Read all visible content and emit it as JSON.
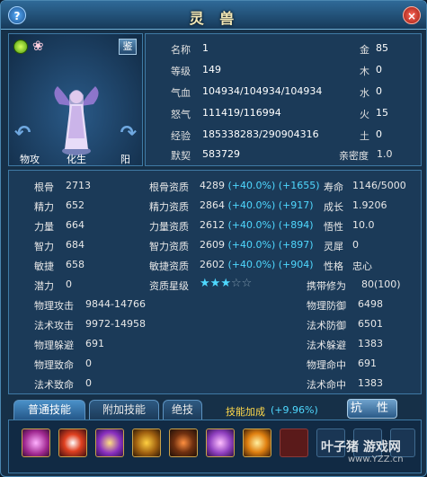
{
  "window": {
    "title": "灵 兽",
    "help": "?",
    "close": "×"
  },
  "portrait": {
    "appraise": "鉴",
    "tags": [
      "物攻",
      "化生",
      "阳"
    ]
  },
  "basic": [
    {
      "label": "名称",
      "value": "1",
      "label2": "金",
      "value2": "85"
    },
    {
      "label": "等级",
      "value": "149",
      "label2": "木",
      "value2": "0"
    },
    {
      "label": "气血",
      "value": "104934/104934/104934",
      "label2": "水",
      "value2": "0"
    },
    {
      "label": "怒气",
      "value": "111419/116994",
      "label2": "火",
      "value2": "15"
    },
    {
      "label": "经验",
      "value": "185338283/290904316",
      "label2": "土",
      "value2": "0"
    },
    {
      "label": "默契",
      "value": "583729",
      "label2": "亲密度",
      "value2": "1.0"
    }
  ],
  "attributes": [
    {
      "l1": "根骨",
      "v1": "2713",
      "l2": "根骨资质",
      "v2": "4289",
      "b1": "(+40.0%)",
      "b2": "(+1655)",
      "l3": "寿命",
      "v3": "1146/5000"
    },
    {
      "l1": "精力",
      "v1": "652",
      "l2": "精力资质",
      "v2": "2864",
      "b1": "(+40.0%)",
      "b2": "(+917)",
      "l3": "成长",
      "v3": "1.9206"
    },
    {
      "l1": "力量",
      "v1": "664",
      "l2": "力量资质",
      "v2": "2612",
      "b1": "(+40.0%)",
      "b2": "(+894)",
      "l3": "悟性",
      "v3": "10.0"
    },
    {
      "l1": "智力",
      "v1": "684",
      "l2": "智力资质",
      "v2": "2609",
      "b1": "(+40.0%)",
      "b2": "(+897)",
      "l3": "灵犀",
      "v3": "0"
    },
    {
      "l1": "敏捷",
      "v1": "658",
      "l2": "敏捷资质",
      "v2": "2602",
      "b1": "(+40.0%)",
      "b2": "(+904)",
      "l3": "性格",
      "v3": "忠心"
    }
  ],
  "potential": {
    "label": "潜力",
    "value": "0",
    "star_label": "资质星级",
    "stars": 2.5,
    "carry_label": "携带修为",
    "carry_value": "80(100)"
  },
  "combat": [
    {
      "l1": "物理攻击",
      "v1": "9844-14766",
      "l2": "物理防御",
      "v2": "6498"
    },
    {
      "l1": "法术攻击",
      "v1": "9972-14958",
      "l2": "法术防御",
      "v2": "6501"
    },
    {
      "l1": "物理躲避",
      "v1": "691",
      "l2": "法术躲避",
      "v2": "1383"
    },
    {
      "l1": "物理致命",
      "v1": "0",
      "l2": "物理命中",
      "v2": "691"
    },
    {
      "l1": "法术致命",
      "v1": "0",
      "l2": "法术命中",
      "v2": "1383"
    }
  ],
  "tabs": [
    "普通技能",
    "附加技能",
    "绝技"
  ],
  "skill_bonus": {
    "label": "技能加成",
    "value": "(+9.96%)"
  },
  "kangxing": "抗 性",
  "watermark": {
    "main": "叶子猪 游戏网",
    "sub": "www.YZZ.cn"
  }
}
